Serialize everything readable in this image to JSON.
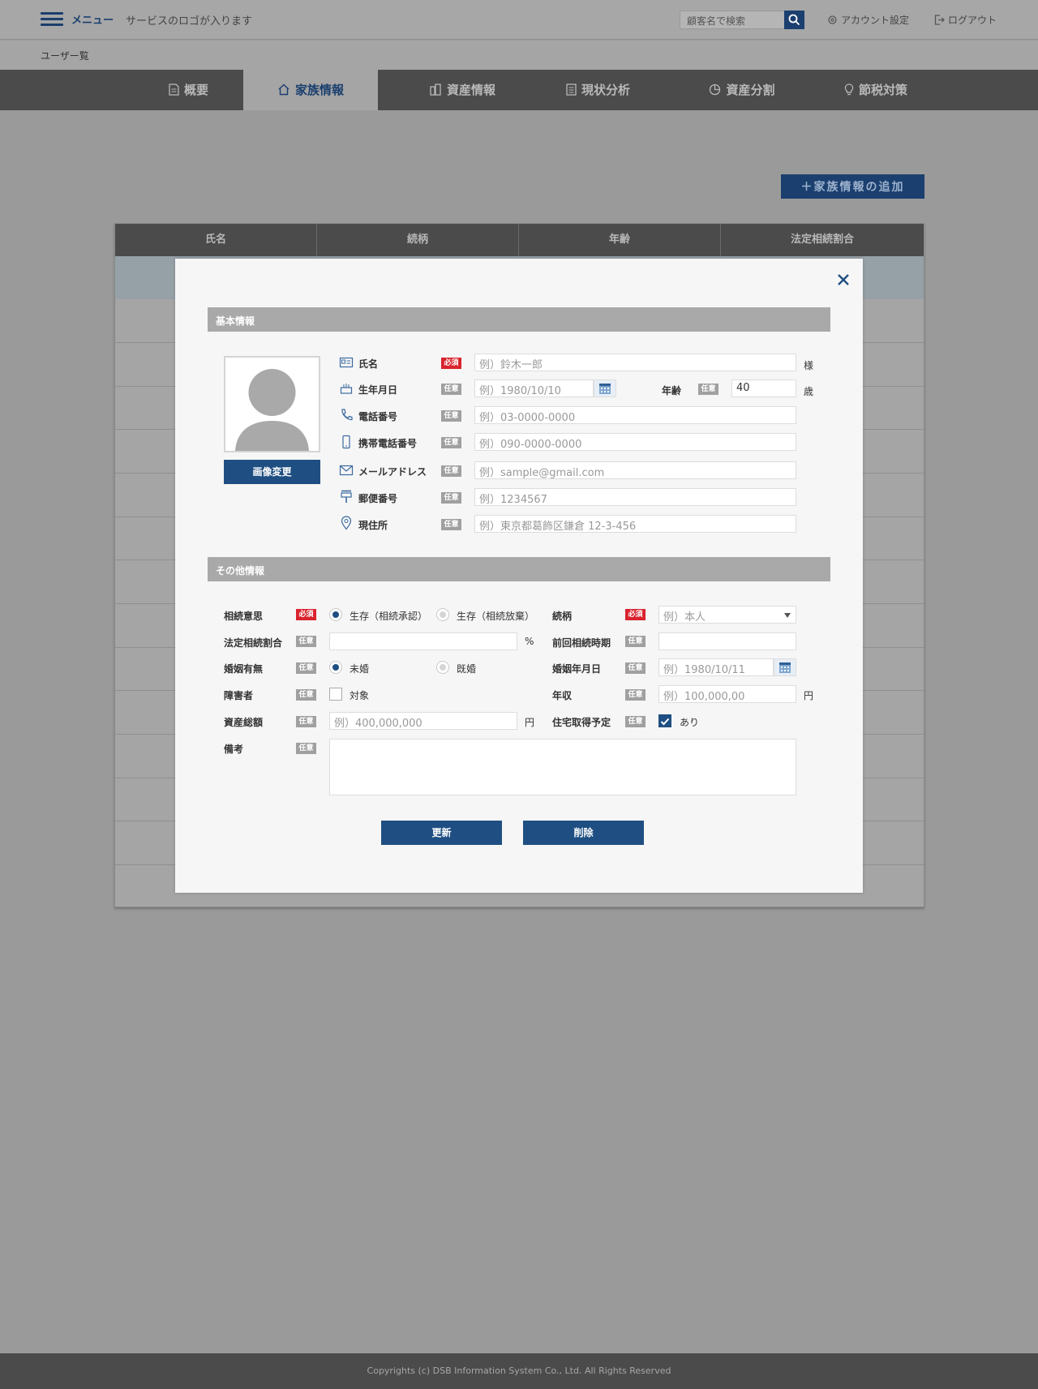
{
  "header": {
    "menu_label": "メニュー",
    "logo_text": "サービスのロゴが入ります",
    "search_placeholder": "顧客名で検索",
    "account_settings": "アカウント設定",
    "logout": "ログアウト"
  },
  "breadcrumb": "ユーザー覧",
  "tabs": [
    {
      "label": "概要",
      "icon": "document-icon"
    },
    {
      "label": "家族情報",
      "icon": "home-icon",
      "active": true
    },
    {
      "label": "資産情報",
      "icon": "buildings-icon"
    },
    {
      "label": "現状分析",
      "icon": "analysis-icon"
    },
    {
      "label": "資産分割",
      "icon": "pie-icon"
    },
    {
      "label": "節税対策",
      "icon": "lightbulb-icon"
    }
  ],
  "add_button": "＋家族情報の追加",
  "table": {
    "headers": [
      "氏名",
      "続柄",
      "年齢",
      "法定相続割合"
    ]
  },
  "modal": {
    "basic_section": "基本情報",
    "other_section": "その他情報",
    "image_change": "画像変更",
    "badge_required": "必須",
    "badge_optional": "任意",
    "basic": {
      "name": {
        "label": "氏名",
        "placeholder": "例）鈴木一郎",
        "suffix": "様"
      },
      "birthday": {
        "label": "生年月日",
        "placeholder": "例）1980/10/10"
      },
      "age": {
        "label": "年齢",
        "value": "40",
        "suffix": "歳"
      },
      "phone": {
        "label": "電話番号",
        "placeholder": "例）03-0000-0000"
      },
      "mobile": {
        "label": "携帯電話番号",
        "placeholder": "例）090-0000-0000"
      },
      "email": {
        "label": "メールアドレス",
        "placeholder": "例）sample@gmail.com"
      },
      "postal": {
        "label": "郵便番号",
        "placeholder": "例）1234567"
      },
      "address": {
        "label": "現住所",
        "placeholder": "例）東京都葛飾区鎌倉 12-3-456"
      }
    },
    "other": {
      "inheritance_intent": {
        "label": "相続意思",
        "option1": "生存（相続承認）",
        "option2": "生存（相続放棄）"
      },
      "relationship": {
        "label": "続柄",
        "placeholder": "例）本人"
      },
      "legal_share": {
        "label": "法定相続割合",
        "unit": "%"
      },
      "previous_inheritance": {
        "label": "前回相続時期"
      },
      "marital": {
        "label": "婚姻有無",
        "option1": "未婚",
        "option2": "既婚"
      },
      "marriage_date": {
        "label": "婚姻年月日",
        "placeholder": "例）1980/10/11"
      },
      "disability": {
        "label": "障害者",
        "option": "対象"
      },
      "annual_income": {
        "label": "年収",
        "placeholder": "例）100,000,00",
        "unit": "円"
      },
      "total_assets": {
        "label": "資産総額",
        "placeholder": "例）400,000,000",
        "unit": "円"
      },
      "housing": {
        "label": "住宅取得予定",
        "option": "あり"
      },
      "notes": {
        "label": "備考"
      }
    },
    "update_button": "更新",
    "delete_button": "削除"
  },
  "footer": "Copyrights (c) DSB Information System Co., Ltd. All Rights Reserved",
  "colors": {
    "accent": "#1f4f82",
    "required": "#d9232e",
    "optional": "#a0a0a0"
  }
}
